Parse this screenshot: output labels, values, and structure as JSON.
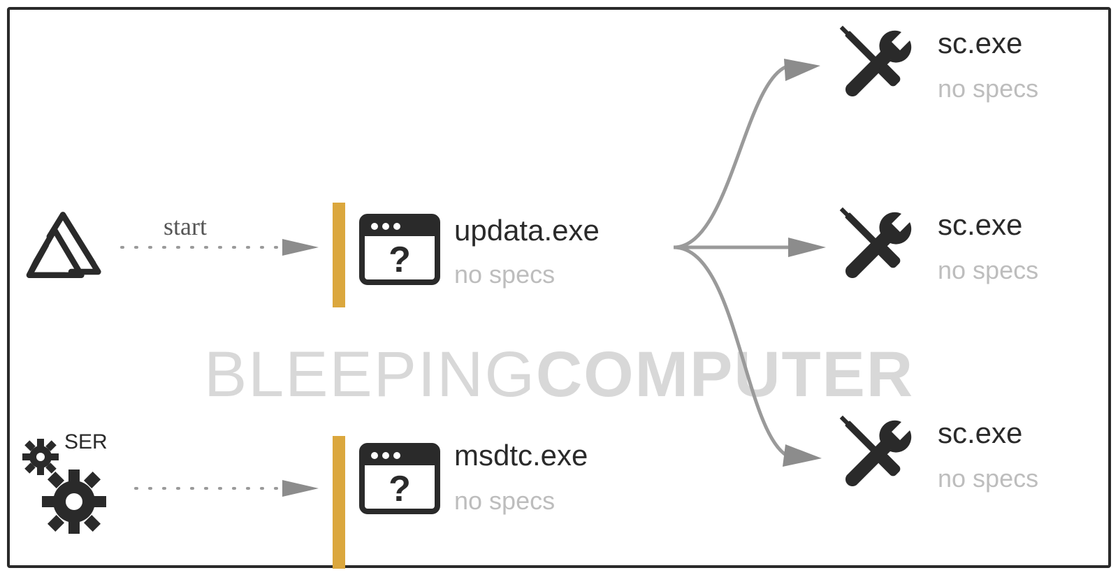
{
  "watermark": {
    "left": "BLEEPING",
    "right": "COMPUTER"
  },
  "nodes": {
    "origin1": {
      "icon": "triangle-loop-icon"
    },
    "origin2": {
      "icon": "gears-icon",
      "label": "SER"
    },
    "proc1": {
      "title": "updata.exe",
      "sub": "no specs"
    },
    "proc2": {
      "title": "msdtc.exe",
      "sub": "no specs"
    },
    "sc1": {
      "title": "sc.exe",
      "sub": "no specs"
    },
    "sc2": {
      "title": "sc.exe",
      "sub": "no specs"
    },
    "sc3": {
      "title": "sc.exe",
      "sub": "no specs"
    }
  },
  "edges": {
    "start": {
      "label": "start"
    }
  }
}
